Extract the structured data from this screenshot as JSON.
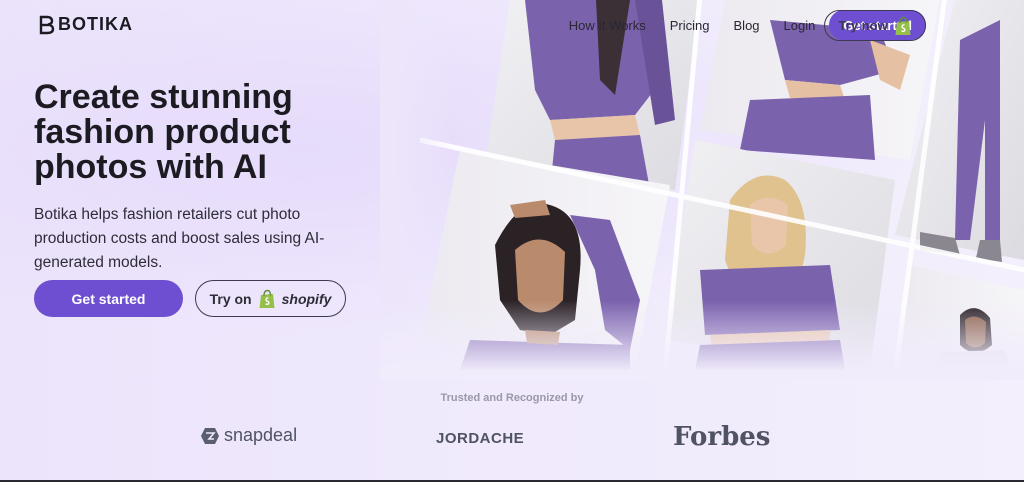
{
  "brand": {
    "name": "BOTIKA"
  },
  "nav": {
    "links": [
      "How It Works",
      "Pricing",
      "Blog",
      "Login"
    ],
    "cta": "Get started",
    "try_now": "Try now"
  },
  "hero": {
    "headline": "Create stunning fashion product photos with AI",
    "subline": "Botika helps fashion retailers cut photo production costs and boost sales using AI-generated models.",
    "primary_button": "Get started",
    "shopify_button_prefix": "Try on",
    "shopify_word": "shopify"
  },
  "trusted": {
    "heading": "Trusted and Recognized by",
    "logos": [
      "snapdeal",
      "JORDACHE",
      "Forbes"
    ]
  },
  "colors": {
    "accent": "#6f4fd1",
    "outfit": "#7a62ad",
    "background": "#efe9fb"
  }
}
